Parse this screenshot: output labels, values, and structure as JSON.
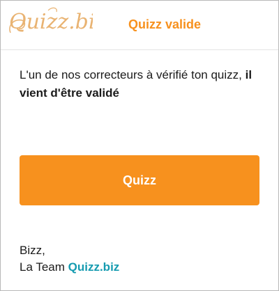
{
  "header": {
    "logo_text": "Quizz.biz",
    "title": "Quizz valide"
  },
  "message": {
    "text": "L'un de nos correcteurs à vérifié ton quizz, ",
    "emphasis": "il vient d'être validé"
  },
  "cta": {
    "label": "Quizz"
  },
  "signature": {
    "greeting": "Bizz,",
    "team_prefix": "La Team ",
    "brand": "Quizz.biz"
  },
  "colors": {
    "accent": "#f7911e",
    "brand": "#159bb0",
    "logo": "#e9b372"
  }
}
